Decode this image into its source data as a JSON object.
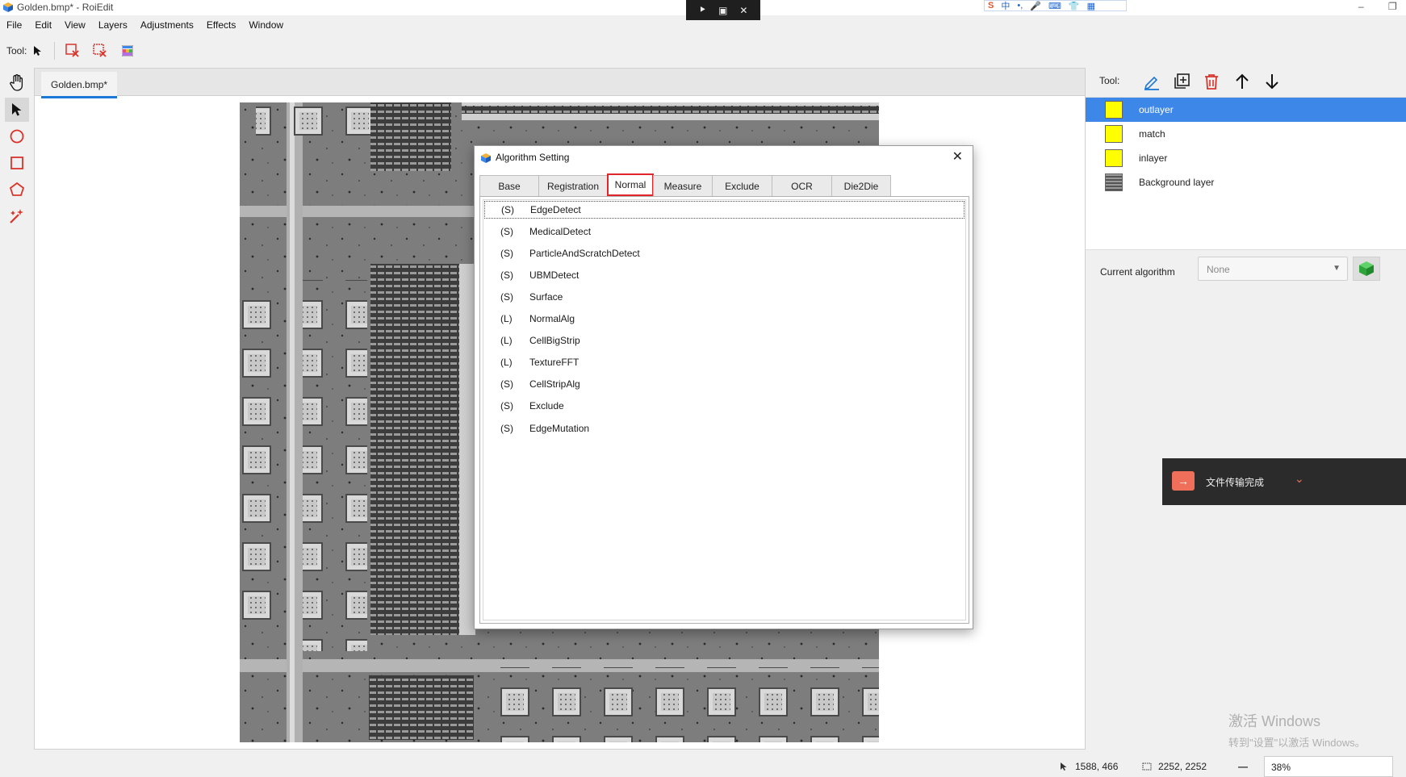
{
  "window": {
    "title": "Golden.bmp* - RoiEdit",
    "minimize": "–",
    "restore": "❐"
  },
  "remote_bar": {
    "pin": "⯈",
    "screen": "▣",
    "close": "✕"
  },
  "ime": {
    "logo": "S",
    "lang": "中",
    "items": [
      "•,",
      "🎤",
      "⌨",
      "👕",
      "▦"
    ]
  },
  "menu": [
    "File",
    "Edit",
    "View",
    "Layers",
    "Adjustments",
    "Effects",
    "Window"
  ],
  "toolbar": {
    "label": "Tool:"
  },
  "document": {
    "tab": "Golden.bmp*"
  },
  "dialog": {
    "title": "Algorithm Setting",
    "close": "✕",
    "tabs": [
      "Base",
      "Registration",
      "Normal",
      "Measure",
      "Exclude",
      "OCR",
      "Die2Die"
    ],
    "active_tab": "Normal",
    "algorithms": [
      {
        "kind": "(S)",
        "name": "EdgeDetect"
      },
      {
        "kind": "(S)",
        "name": "MedicalDetect"
      },
      {
        "kind": "(S)",
        "name": "ParticleAndScratchDetect"
      },
      {
        "kind": "(S)",
        "name": "UBMDetect"
      },
      {
        "kind": "(S)",
        "name": "Surface"
      },
      {
        "kind": "(L)",
        "name": "NormalAlg"
      },
      {
        "kind": "(L)",
        "name": "CellBigStrip"
      },
      {
        "kind": "(L)",
        "name": "TextureFFT"
      },
      {
        "kind": "(S)",
        "name": "CellStripAlg"
      },
      {
        "kind": "(S)",
        "name": "Exclude"
      },
      {
        "kind": "(S)",
        "name": "EdgeMutation"
      }
    ]
  },
  "right_panel": {
    "tool_label": "Tool:",
    "layers": [
      {
        "name": "outlayer",
        "color": "#ffff00",
        "selected": true
      },
      {
        "name": "match",
        "color": "#ffff00",
        "selected": false
      },
      {
        "name": "inlayer",
        "color": "#ffff00",
        "selected": false
      },
      {
        "name": "Background layer",
        "color": "#6a6a6a",
        "selected": false
      }
    ],
    "current_algorithm_label": "Current algorithm",
    "current_algorithm_value": "None"
  },
  "toast": {
    "text": "文件传输完成",
    "chevron": "⌄"
  },
  "watermark": {
    "line1": "激活 Windows",
    "line2": "转到\"设置\"以激活 Windows。"
  },
  "status": {
    "cursor": "1588, 466",
    "size": "2252, 2252",
    "zoom_minus": "—",
    "zoom": "38%"
  },
  "colors": {
    "accent": "#1a78d6",
    "selection": "#3d87e8",
    "highlight_border": "#e0262a",
    "delete": "#d9342b"
  }
}
